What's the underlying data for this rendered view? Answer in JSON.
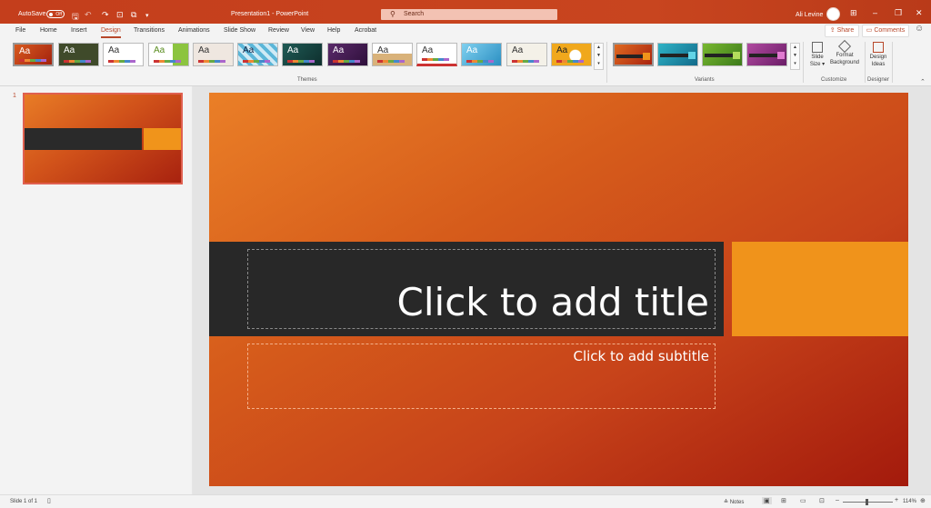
{
  "titlebar": {
    "autosave_label": "AutoSave",
    "autosave_state": "Off",
    "window_title": "Presentation1  -  PowerPoint",
    "search_placeholder": "Search",
    "user_name": "Ali Levine",
    "color": "#c43e1c"
  },
  "tabs": [
    {
      "label": "File"
    },
    {
      "label": "Home"
    },
    {
      "label": "Insert"
    },
    {
      "label": "Design",
      "active": true
    },
    {
      "label": "Transitions"
    },
    {
      "label": "Animations"
    },
    {
      "label": "Slide Show"
    },
    {
      "label": "Review"
    },
    {
      "label": "View"
    },
    {
      "label": "Help"
    },
    {
      "label": "Acrobat"
    }
  ],
  "share_label": "Share",
  "comments_label": "Comments",
  "ribbon": {
    "themes_label": "Themes",
    "variants_label": "Variants",
    "customize_label": "Customize",
    "designer_label": "Designer",
    "slide_size_label_1": "Slide",
    "slide_size_label_2": "Size",
    "format_bg_label_1": "Format",
    "format_bg_label_2": "Background",
    "design_ideas_label_1": "Design",
    "design_ideas_label_2": "Ideas",
    "theme_sample_text": "Aa"
  },
  "slide_panel": {
    "slide_number": "1"
  },
  "slide": {
    "title_placeholder": "Click to add title",
    "subtitle_placeholder": "Click to add subtitle"
  },
  "status": {
    "slide_indicator": "Slide 1 of 1",
    "notes_label": "Notes",
    "zoom": "114%"
  }
}
